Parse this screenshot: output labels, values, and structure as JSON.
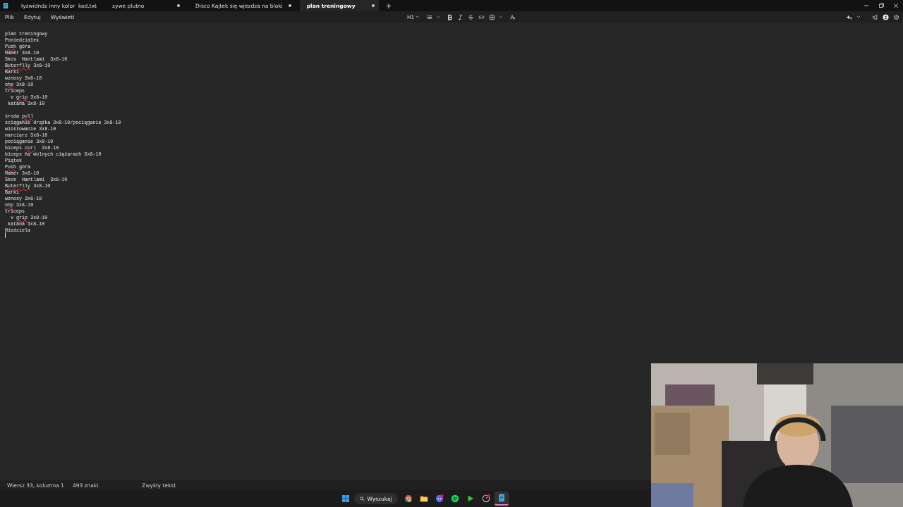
{
  "tabs": [
    {
      "title": "łyżwidndz inny kolor  kod.txt",
      "modified": false,
      "selected": false
    },
    {
      "title": "zywe plutno",
      "modified": true,
      "selected": false
    },
    {
      "title": "Disco Kajtek się wjezdza na bloki",
      "modified": true,
      "selected": false
    },
    {
      "title": "plan treningowy",
      "modified": true,
      "selected": true
    }
  ],
  "new_tab": "+",
  "menu": [
    "Plik",
    "Edytuj",
    "Wyświetl"
  ],
  "toolbar": {
    "heading": "H1"
  },
  "editor": {
    "cursor_visible": true,
    "lines": [
      {
        "kind": "text",
        "parts": [
          {
            "text": "plan treningowy",
            "misspelled": false
          }
        ]
      },
      {
        "kind": "text",
        "parts": [
          {
            "text": "Poniedziałek",
            "misspelled": false
          }
        ]
      },
      {
        "kind": "text",
        "parts": [
          {
            "text": "Push",
            "misspelled": true
          },
          {
            "text": " góra",
            "misspelled": false
          }
        ]
      },
      {
        "kind": "text",
        "parts": [
          {
            "text": "Hamer 3x8-10",
            "misspelled": false
          }
        ]
      },
      {
        "kind": "text",
        "parts": [
          {
            "text": "Skos  Hantlami  3x8-10",
            "misspelled": false
          }
        ]
      },
      {
        "kind": "text",
        "parts": [
          {
            "text": "Buterflly",
            "misspelled": true
          },
          {
            "text": " 3x8-10",
            "misspelled": false
          }
        ]
      },
      {
        "kind": "text",
        "parts": [
          {
            "text": "Barki",
            "misspelled": false
          }
        ]
      },
      {
        "kind": "text",
        "parts": [
          {
            "text": "wznosy 3x8-10",
            "misspelled": false
          }
        ]
      },
      {
        "kind": "text",
        "parts": [
          {
            "text": "ohp",
            "misspelled": true
          },
          {
            "text": " 3x8-10",
            "misspelled": false
          }
        ]
      },
      {
        "kind": "text",
        "parts": [
          {
            "text": "triceps",
            "misspelled": false
          }
        ]
      },
      {
        "kind": "text",
        "parts": [
          {
            "text": "  v ",
            "misspelled": false
          },
          {
            "text": "grip",
            "misspelled": true
          },
          {
            "text": " 3x8-10",
            "misspelled": false
          }
        ]
      },
      {
        "kind": "text",
        "parts": [
          {
            "text": " katana 3x8-10",
            "misspelled": false
          }
        ]
      },
      {
        "kind": "blank"
      },
      {
        "kind": "text",
        "parts": [
          {
            "text": "środa ",
            "misspelled": false
          },
          {
            "text": "pull",
            "misspelled": true
          }
        ]
      },
      {
        "kind": "text",
        "parts": [
          {
            "text": "sciąganie drążka 3x8-10/pociąganie 3x8-10",
            "misspelled": false
          }
        ]
      },
      {
        "kind": "text",
        "parts": [
          {
            "text": "wiosłowanie 3x8-10",
            "misspelled": false
          }
        ]
      },
      {
        "kind": "text",
        "parts": [
          {
            "text": "narciarz 3x8-10",
            "misspelled": false
          }
        ]
      },
      {
        "kind": "text",
        "parts": [
          {
            "text": "pociąganie 3x8-10",
            "misspelled": false
          }
        ]
      },
      {
        "kind": "text",
        "parts": [
          {
            "text": "biceps ",
            "misspelled": false
          },
          {
            "text": "curl",
            "misspelled": true
          },
          {
            "text": "  3x8-10",
            "misspelled": false
          }
        ]
      },
      {
        "kind": "text",
        "parts": [
          {
            "text": "biceps na wolnych ciężarach 3x8-10",
            "misspelled": false
          }
        ]
      },
      {
        "kind": "text",
        "parts": [
          {
            "text": "Piątek",
            "misspelled": false
          }
        ]
      },
      {
        "kind": "text",
        "parts": [
          {
            "text": "Push",
            "misspelled": true
          },
          {
            "text": " góra",
            "misspelled": false
          }
        ]
      },
      {
        "kind": "text",
        "parts": [
          {
            "text": "Hamer 3x8-10",
            "misspelled": false
          }
        ]
      },
      {
        "kind": "text",
        "parts": [
          {
            "text": "Skos  Hantlami  3x8-10",
            "misspelled": false
          }
        ]
      },
      {
        "kind": "text",
        "parts": [
          {
            "text": "Buterflly",
            "misspelled": true
          },
          {
            "text": " 3x8-10",
            "misspelled": false
          }
        ]
      },
      {
        "kind": "text",
        "parts": [
          {
            "text": "Barki",
            "misspelled": false
          }
        ]
      },
      {
        "kind": "text",
        "parts": [
          {
            "text": "wznosy 3x8-10",
            "misspelled": false
          }
        ]
      },
      {
        "kind": "text",
        "parts": [
          {
            "text": "ohp",
            "misspelled": true
          },
          {
            "text": " 3x8-10",
            "misspelled": false
          }
        ]
      },
      {
        "kind": "text",
        "parts": [
          {
            "text": "triceps",
            "misspelled": false
          }
        ]
      },
      {
        "kind": "text",
        "parts": [
          {
            "text": "  v ",
            "misspelled": false
          },
          {
            "text": "grip",
            "misspelled": true
          },
          {
            "text": " 3x8-10",
            "misspelled": false
          }
        ]
      },
      {
        "kind": "text",
        "parts": [
          {
            "text": " katana 3x8-10",
            "misspelled": false
          }
        ]
      },
      {
        "kind": "text",
        "parts": [
          {
            "text": "Niedziela",
            "misspelled": false
          }
        ]
      }
    ]
  },
  "status_bar": {
    "position": "Wiersz 33, kolumna 1",
    "characters": "493 znaki",
    "format": "Zwykły tekst"
  },
  "taskbar": {
    "search": "Wyszukaj",
    "apps": [
      {
        "kind": "browser",
        "active": false,
        "notification": false
      },
      {
        "kind": "folder",
        "active": false,
        "notification": false
      },
      {
        "kind": "chat",
        "active": false,
        "notification": true
      },
      {
        "kind": "music",
        "active": false,
        "notification": false
      },
      {
        "kind": "play",
        "active": false,
        "notification": false
      },
      {
        "kind": "gauge",
        "active": false,
        "notification": true
      },
      {
        "kind": "notepad",
        "active": true,
        "notification": false
      }
    ]
  },
  "webcam": {
    "kind": "picture"
  }
}
